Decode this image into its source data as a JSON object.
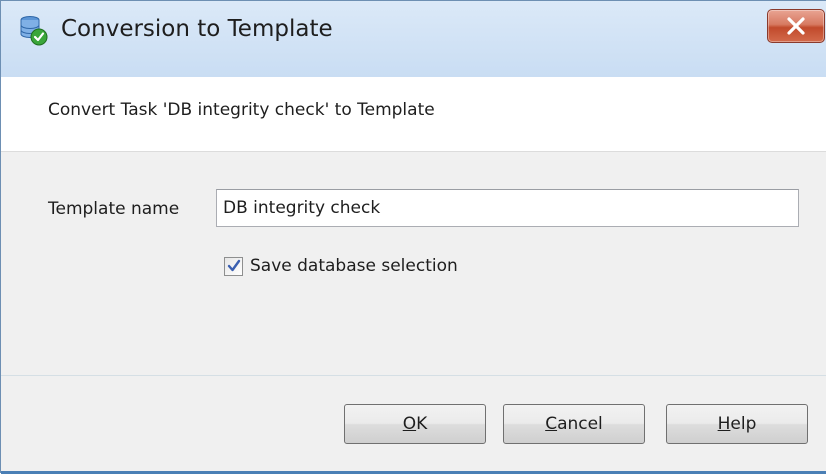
{
  "window": {
    "title": "Conversion to Template",
    "icon": "database-check-icon",
    "close_icon": "close-icon",
    "close_color": "#c9543a"
  },
  "header": {
    "text": "Convert Task 'DB integrity check' to Template"
  },
  "form": {
    "template_name_label": "Template name",
    "template_name_value": "DB integrity check",
    "save_selection_label": "Save database selection",
    "save_selection_checked": true
  },
  "buttons": {
    "ok": {
      "accel": "O",
      "rest": "K"
    },
    "cancel": {
      "accel": "C",
      "rest": "ancel"
    },
    "help": {
      "accel": "H",
      "rest": "elp"
    }
  }
}
